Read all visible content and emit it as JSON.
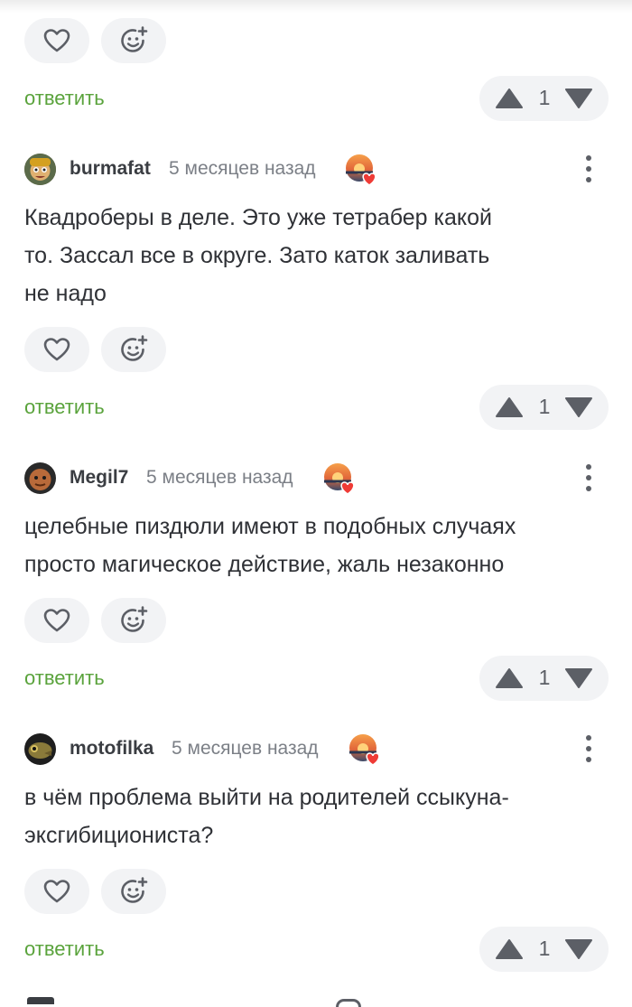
{
  "reply_label": "ответить",
  "top_block": {
    "votes": "1"
  },
  "comments": [
    {
      "username": "burmafat",
      "time": "5 месяцев назад",
      "text_lines": [
        "Квадроберы в деле. Это уже тетрабер какой",
        "то. Зассал все в округе. Зато каток заливать",
        "не надо"
      ],
      "votes": "1"
    },
    {
      "username": "Megil7",
      "time": "5 месяцев назад",
      "text_lines": [
        "целебные пиздюли имеют в подобных случаях",
        "просто магическое действие, жаль незаконно"
      ],
      "votes": "1"
    },
    {
      "username": "motofilka",
      "time": "5 месяцев назад",
      "text_lines": [
        "в чём проблема выйти на родителей ссыкуна-",
        "эксгибициониста?"
      ],
      "votes": "1"
    }
  ],
  "icons": {
    "like": "heart-icon",
    "react": "smiley-add-icon",
    "up": "arrow-up-icon",
    "down": "arrow-down-icon",
    "more": "more-dots-icon",
    "badge": "sunset-heart-badge-icon"
  },
  "colors": {
    "reply": "#5aa33c",
    "pill_bg": "#f2f3f5",
    "icon": "#5c5f66"
  }
}
